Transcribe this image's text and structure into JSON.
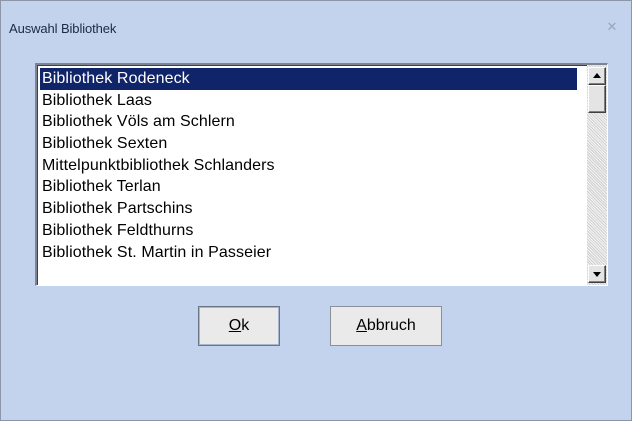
{
  "dialog": {
    "title": "Auswahl Bibliothek",
    "close_icon": "close-x-icon"
  },
  "list": {
    "selected_index": 0,
    "items": [
      "Bibliothek Rodeneck",
      "Bibliothek Laas",
      "Bibliothek Völs am Schlern",
      "Bibliothek Sexten",
      "Mittelpunktbibliothek Schlanders",
      "Bibliothek Terlan",
      "Bibliothek Partschins",
      "Bibliothek Feldthurns",
      "Bibliothek St. Martin in Passeier"
    ]
  },
  "buttons": {
    "ok_mnemonic": "O",
    "ok_rest": "k",
    "cancel_mnemonic": "A",
    "cancel_rest": "bbruch"
  },
  "colors": {
    "dialog_bg": "#c3d3ed",
    "selection_bg": "#10246a",
    "selection_text": "#ffffff"
  }
}
